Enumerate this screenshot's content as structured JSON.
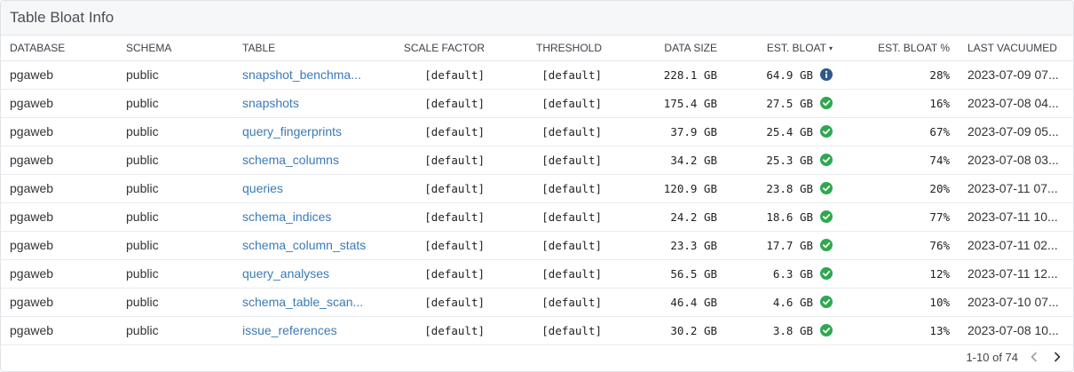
{
  "panel": {
    "title": "Table Bloat Info"
  },
  "columns": [
    {
      "key": "database",
      "label": "DATABASE",
      "align": "left"
    },
    {
      "key": "schema",
      "label": "SCHEMA",
      "align": "left"
    },
    {
      "key": "table",
      "label": "TABLE",
      "align": "left"
    },
    {
      "key": "scale_factor",
      "label": "SCALE FACTOR",
      "align": "right"
    },
    {
      "key": "threshold",
      "label": "THRESHOLD",
      "align": "right"
    },
    {
      "key": "data_size",
      "label": "DATA SIZE",
      "align": "right"
    },
    {
      "key": "est_bloat",
      "label": "EST. BLOAT",
      "align": "right",
      "sorted": "desc"
    },
    {
      "key": "est_bloat_pct",
      "label": "EST. BLOAT %",
      "align": "right"
    },
    {
      "key": "last_vacuumed",
      "label": "LAST VACUUMED",
      "align": "left"
    }
  ],
  "rows": [
    {
      "database": "pgaweb",
      "schema": "public",
      "table": "snapshot_benchma...",
      "scale_factor": "[default]",
      "threshold": "[default]",
      "data_size": "228.1 GB",
      "est_bloat": "64.9 GB",
      "status_icon": "info-icon",
      "est_bloat_pct": "28%",
      "last_vacuumed": "2023-07-09 07..."
    },
    {
      "database": "pgaweb",
      "schema": "public",
      "table": "snapshots",
      "scale_factor": "[default]",
      "threshold": "[default]",
      "data_size": "175.4 GB",
      "est_bloat": "27.5 GB",
      "status_icon": "check-circle-icon",
      "est_bloat_pct": "16%",
      "last_vacuumed": "2023-07-08 04..."
    },
    {
      "database": "pgaweb",
      "schema": "public",
      "table": "query_fingerprints",
      "scale_factor": "[default]",
      "threshold": "[default]",
      "data_size": "37.9 GB",
      "est_bloat": "25.4 GB",
      "status_icon": "check-circle-icon",
      "est_bloat_pct": "67%",
      "last_vacuumed": "2023-07-09 05..."
    },
    {
      "database": "pgaweb",
      "schema": "public",
      "table": "schema_columns",
      "scale_factor": "[default]",
      "threshold": "[default]",
      "data_size": "34.2 GB",
      "est_bloat": "25.3 GB",
      "status_icon": "check-circle-icon",
      "est_bloat_pct": "74%",
      "last_vacuumed": "2023-07-08 03..."
    },
    {
      "database": "pgaweb",
      "schema": "public",
      "table": "queries",
      "scale_factor": "[default]",
      "threshold": "[default]",
      "data_size": "120.9 GB",
      "est_bloat": "23.8 GB",
      "status_icon": "check-circle-icon",
      "est_bloat_pct": "20%",
      "last_vacuumed": "2023-07-11 07..."
    },
    {
      "database": "pgaweb",
      "schema": "public",
      "table": "schema_indices",
      "scale_factor": "[default]",
      "threshold": "[default]",
      "data_size": "24.2 GB",
      "est_bloat": "18.6 GB",
      "status_icon": "check-circle-icon",
      "est_bloat_pct": "77%",
      "last_vacuumed": "2023-07-11 10..."
    },
    {
      "database": "pgaweb",
      "schema": "public",
      "table": "schema_column_stats",
      "scale_factor": "[default]",
      "threshold": "[default]",
      "data_size": "23.3 GB",
      "est_bloat": "17.7 GB",
      "status_icon": "check-circle-icon",
      "est_bloat_pct": "76%",
      "last_vacuumed": "2023-07-11 02..."
    },
    {
      "database": "pgaweb",
      "schema": "public",
      "table": "query_analyses",
      "scale_factor": "[default]",
      "threshold": "[default]",
      "data_size": "56.5 GB",
      "est_bloat": "6.3 GB",
      "status_icon": "check-circle-icon",
      "est_bloat_pct": "12%",
      "last_vacuumed": "2023-07-11 12..."
    },
    {
      "database": "pgaweb",
      "schema": "public",
      "table": "schema_table_scan...",
      "scale_factor": "[default]",
      "threshold": "[default]",
      "data_size": "46.4 GB",
      "est_bloat": "4.6 GB",
      "status_icon": "check-circle-icon",
      "est_bloat_pct": "10%",
      "last_vacuumed": "2023-07-10 07..."
    },
    {
      "database": "pgaweb",
      "schema": "public",
      "table": "issue_references",
      "scale_factor": "[default]",
      "threshold": "[default]",
      "data_size": "30.2 GB",
      "est_bloat": "3.8 GB",
      "status_icon": "check-circle-icon",
      "est_bloat_pct": "13%",
      "last_vacuumed": "2023-07-08 10..."
    }
  ],
  "pagination": {
    "label": "1-10 of 74",
    "prev_icon": "chevron-left-icon",
    "next_icon": "chevron-right-icon"
  },
  "colors": {
    "link": "#3a7ab8",
    "info": "#2d5a8a",
    "ok": "#2fa84f",
    "header_bg": "#f5f7f9"
  }
}
